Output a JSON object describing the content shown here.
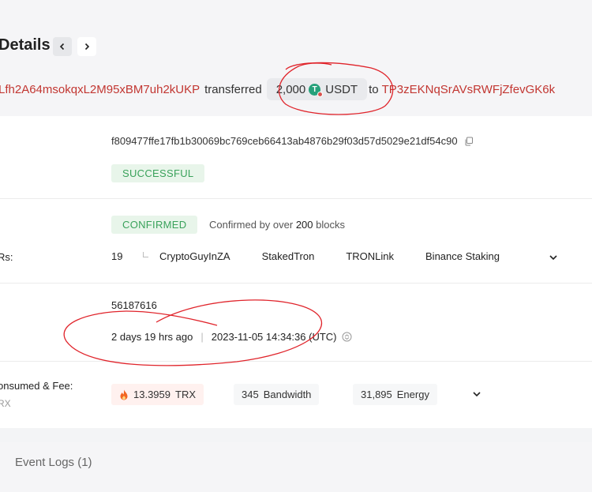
{
  "header": {
    "title": "Details",
    "prev_label": "previous",
    "next_label": "next"
  },
  "transfer": {
    "from_address": "Lfh2A64msokqxL2M95xBM7uh2kUKP",
    "verb": "transferred",
    "amount": "2,000",
    "token_symbol": "USDT",
    "token_icon": "tether-icon",
    "to_word": "to",
    "to_address": "TP3zEKNqSrAVsRWFjZfevGK6k"
  },
  "hash": {
    "value": "f809477ffe17fb1b30069bc769ceb66413ab4876b29f03d57d5029e21df54c90",
    "copy_icon": "copy-icon"
  },
  "result": {
    "status": "SUCCESSFUL"
  },
  "confirmation": {
    "status": "CONFIRMED",
    "note_prefix": "Confirmed by over ",
    "note_count": "200",
    "note_suffix": " blocks"
  },
  "super_representatives": {
    "label_fragment": "Rs:",
    "count": "19",
    "items": [
      "CryptoGuyInZA",
      "StakedTron",
      "TRONLink",
      "Binance Staking"
    ]
  },
  "block": {
    "number": "56187616",
    "age": "2 days 19 hrs ago",
    "timestamp": "2023-11-05 14:34:36 (UTC)"
  },
  "resources": {
    "label_fragment": "onsumed & Fee:",
    "sub_label_fragment": "RX",
    "trx_value": "13.3959",
    "trx_unit": "TRX",
    "bandwidth_value": "345",
    "bandwidth_unit": "Bandwidth",
    "energy_value": "31,895",
    "energy_unit": "Energy"
  },
  "event_logs": {
    "label": "Event Logs (1)"
  },
  "colors": {
    "address_red": "#c23631",
    "success_green": "#3aa25b",
    "annotation_red": "#e0242b",
    "tether_green": "#26a17b"
  }
}
